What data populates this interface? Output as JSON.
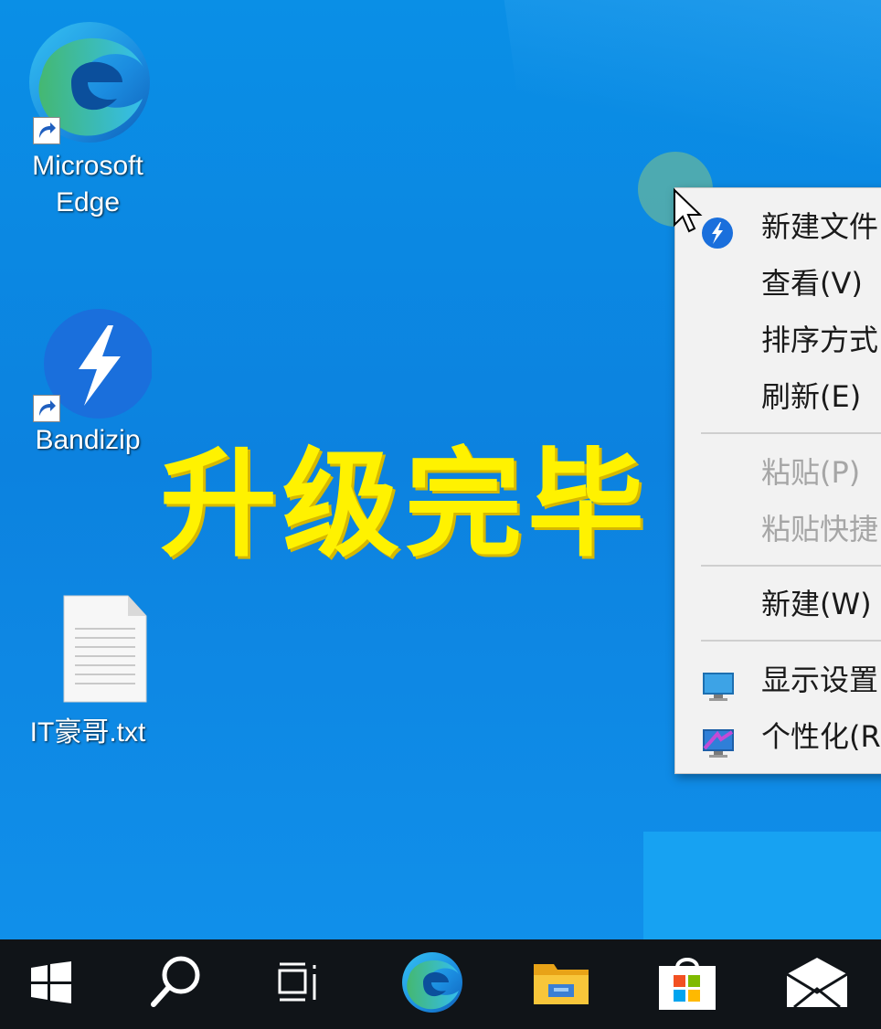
{
  "desktop": {
    "icons": [
      {
        "label_line1": "Microsoft",
        "label_line2": "Edge",
        "icon": "edge-icon"
      },
      {
        "label": "Bandizip",
        "icon": "bandizip-icon"
      },
      {
        "label": "IT豪哥.txt",
        "icon": "text-file-icon"
      }
    ],
    "overlay_title": "升级完毕"
  },
  "context_menu": {
    "items": [
      {
        "label": "新建文件",
        "icon": "bandizip-icon"
      },
      {
        "label": "查看(V)"
      },
      {
        "label": "排序方式"
      },
      {
        "label": "刷新(E)"
      },
      {
        "label": "粘贴(P)",
        "disabled": true
      },
      {
        "label": "粘贴快捷",
        "disabled": true
      },
      {
        "label": "新建(W)"
      },
      {
        "label": "显示设置",
        "icon": "display-icon"
      },
      {
        "label": "个性化(R",
        "icon": "personalize-icon"
      }
    ]
  },
  "taskbar": {
    "items": [
      "start-icon",
      "search-icon",
      "task-view-icon",
      "edge-icon",
      "file-explorer-icon",
      "store-icon",
      "mail-icon"
    ]
  },
  "colors": {
    "desktop_bg": "#0a8fe6",
    "overlay_text": "#fff200",
    "taskbar_bg": "#101418",
    "menu_bg": "#f2f2f2"
  }
}
